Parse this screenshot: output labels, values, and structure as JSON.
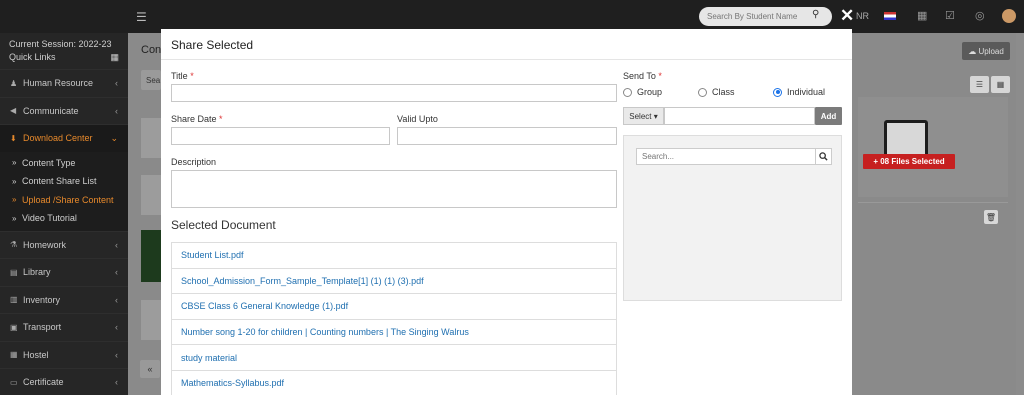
{
  "topbar": {
    "menu_icon": "hamburger-icon",
    "search_placeholder": "Search By Student Name",
    "currency": "NR",
    "icons": [
      "flag-icon",
      "calendar-icon",
      "checklist-icon",
      "whatsapp-icon",
      "user-avatar"
    ]
  },
  "sidebar": {
    "session": "Current Session: 2022-23",
    "quick_links": "Quick Links",
    "items": [
      {
        "icon": "users-icon",
        "label": "Human Resource"
      },
      {
        "icon": "megaphone-icon",
        "label": "Communicate"
      },
      {
        "icon": "download-icon",
        "label": "Download Center"
      },
      {
        "icon": "flask-icon",
        "label": "Homework"
      },
      {
        "icon": "book-icon",
        "label": "Library"
      },
      {
        "icon": "inventory-icon",
        "label": "Inventory"
      },
      {
        "icon": "bus-icon",
        "label": "Transport"
      },
      {
        "icon": "building-icon",
        "label": "Hostel"
      },
      {
        "icon": "certificate-icon",
        "label": "Certificate"
      }
    ],
    "submenu": [
      {
        "label": "Content Type"
      },
      {
        "label": "Content Share List"
      },
      {
        "label": "Upload /Share Content"
      },
      {
        "label": "Video Tutorial"
      }
    ]
  },
  "background": {
    "content_title": "Con",
    "search_stub": "Sea",
    "upload_label": "Upload",
    "files_selected": "+ 08 Files Selected",
    "pager_prev": "«"
  },
  "modal": {
    "title": "Share Selected",
    "close": "✕",
    "title_label": "Title",
    "share_date_label": "Share Date",
    "valid_upto_label": "Valid Upto",
    "description_label": "Description",
    "selected_document_label": "Selected Document",
    "documents": [
      "Student List.pdf",
      "School_Admission_Form_Sample_Template[1] (1) (1) (3).pdf",
      "CBSE Class 6 General Knowledge (1).pdf",
      "Number song 1-20 for children | Counting numbers | The Singing Walrus",
      "study material",
      "Mathematics-Syllabus.pdf"
    ],
    "send_to_label": "Send To",
    "send_to_options": [
      "Group",
      "Class",
      "Individual"
    ],
    "send_to_selected": "Individual",
    "select_label": "Select ▾",
    "add_label": "Add",
    "panel_search_placeholder": "Search..."
  },
  "colors": {
    "sidebar_bg": "#262626",
    "active_accent": "#e88a2c",
    "link_blue": "#1f6fb0",
    "badge_red": "#c62020"
  }
}
